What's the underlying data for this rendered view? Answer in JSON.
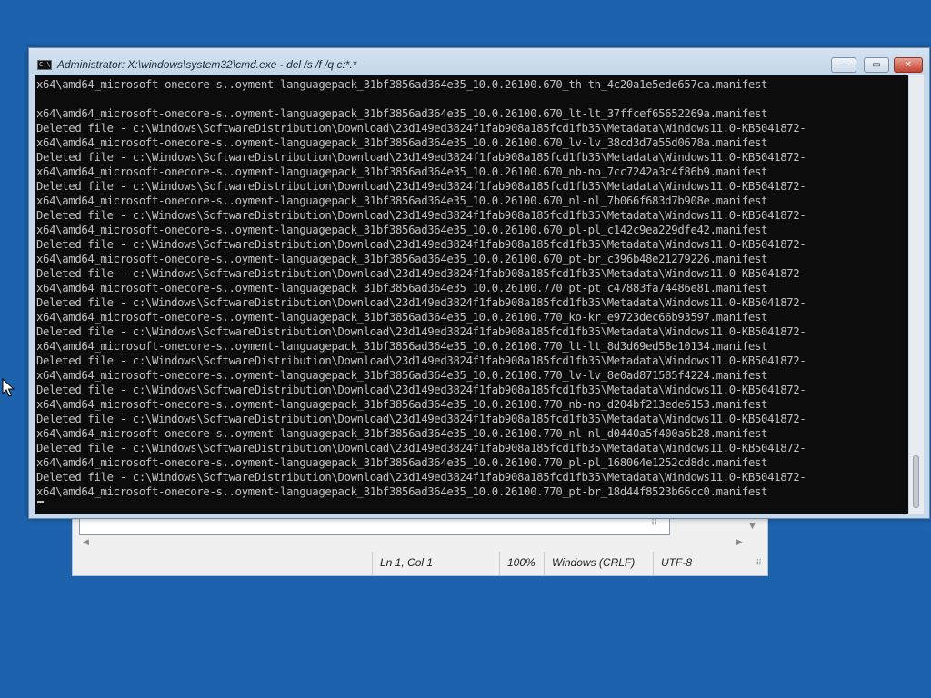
{
  "cmd_window": {
    "title": "Administrator: X:\\windows\\system32\\cmd.exe - del  /s /f /q c:*.*",
    "icon_text": "C:\\",
    "controls": {
      "minimize": "—",
      "maximize": "▭",
      "close": "✕"
    },
    "lines": [
      "x64\\amd64_microsoft-onecore-s..oyment-languagepack_31bf3856ad364e35_10.0.26100.670_th-th_4c20a1e5ede657ca.manifest",
      "",
      "x64\\amd64_microsoft-onecore-s..oyment-languagepack_31bf3856ad364e35_10.0.26100.670_lt-lt_37ffcef65652269a.manifest",
      "Deleted file - c:\\Windows\\SoftwareDistribution\\Download\\23d149ed3824f1fab908a185fcd1fb35\\Metadata\\Windows11.0-KB5041872-",
      "x64\\amd64_microsoft-onecore-s..oyment-languagepack_31bf3856ad364e35_10.0.26100.670_lv-lv_38cd3d7a55d0678a.manifest",
      "Deleted file - c:\\Windows\\SoftwareDistribution\\Download\\23d149ed3824f1fab908a185fcd1fb35\\Metadata\\Windows11.0-KB5041872-",
      "x64\\amd64_microsoft-onecore-s..oyment-languagepack_31bf3856ad364e35_10.0.26100.670_nb-no_7cc7242a3c4f86b9.manifest",
      "Deleted file - c:\\Windows\\SoftwareDistribution\\Download\\23d149ed3824f1fab908a185fcd1fb35\\Metadata\\Windows11.0-KB5041872-",
      "x64\\amd64_microsoft-onecore-s..oyment-languagepack_31bf3856ad364e35_10.0.26100.670_nl-nl_7b066f683d7b908e.manifest",
      "Deleted file - c:\\Windows\\SoftwareDistribution\\Download\\23d149ed3824f1fab908a185fcd1fb35\\Metadata\\Windows11.0-KB5041872-",
      "x64\\amd64_microsoft-onecore-s..oyment-languagepack_31bf3856ad364e35_10.0.26100.670_pl-pl_c142c9ea229dfe42.manifest",
      "Deleted file - c:\\Windows\\SoftwareDistribution\\Download\\23d149ed3824f1fab908a185fcd1fb35\\Metadata\\Windows11.0-KB5041872-",
      "x64\\amd64_microsoft-onecore-s..oyment-languagepack_31bf3856ad364e35_10.0.26100.670_pt-br_c396b48e21279226.manifest",
      "Deleted file - c:\\Windows\\SoftwareDistribution\\Download\\23d149ed3824f1fab908a185fcd1fb35\\Metadata\\Windows11.0-KB5041872-",
      "x64\\amd64_microsoft-onecore-s..oyment-languagepack_31bf3856ad364e35_10.0.26100.770_pt-pt_c47883fa74486e81.manifest",
      "Deleted file - c:\\Windows\\SoftwareDistribution\\Download\\23d149ed3824f1fab908a185fcd1fb35\\Metadata\\Windows11.0-KB5041872-",
      "x64\\amd64_microsoft-onecore-s..oyment-languagepack_31bf3856ad364e35_10.0.26100.770_ko-kr_e9723dec66b93597.manifest",
      "Deleted file - c:\\Windows\\SoftwareDistribution\\Download\\23d149ed3824f1fab908a185fcd1fb35\\Metadata\\Windows11.0-KB5041872-",
      "x64\\amd64_microsoft-onecore-s..oyment-languagepack_31bf3856ad364e35_10.0.26100.770_lt-lt_8d3d69ed58e10134.manifest",
      "Deleted file - c:\\Windows\\SoftwareDistribution\\Download\\23d149ed3824f1fab908a185fcd1fb35\\Metadata\\Windows11.0-KB5041872-",
      "x64\\amd64_microsoft-onecore-s..oyment-languagepack_31bf3856ad364e35_10.0.26100.770_lv-lv_8e0ad871585f4224.manifest",
      "Deleted file - c:\\Windows\\SoftwareDistribution\\Download\\23d149ed3824f1fab908a185fcd1fb35\\Metadata\\Windows11.0-KB5041872-",
      "x64\\amd64_microsoft-onecore-s..oyment-languagepack_31bf3856ad364e35_10.0.26100.770_nb-no_d204bf213ede6153.manifest",
      "Deleted file - c:\\Windows\\SoftwareDistribution\\Download\\23d149ed3824f1fab908a185fcd1fb35\\Metadata\\Windows11.0-KB5041872-",
      "x64\\amd64_microsoft-onecore-s..oyment-languagepack_31bf3856ad364e35_10.0.26100.770_nl-nl_d0440a5f400a6b28.manifest",
      "Deleted file - c:\\Windows\\SoftwareDistribution\\Download\\23d149ed3824f1fab908a185fcd1fb35\\Metadata\\Windows11.0-KB5041872-",
      "x64\\amd64_microsoft-onecore-s..oyment-languagepack_31bf3856ad364e35_10.0.26100.770_pl-pl_168064e1252cd8dc.manifest",
      "Deleted file - c:\\Windows\\SoftwareDistribution\\Download\\23d149ed3824f1fab908a185fcd1fb35\\Metadata\\Windows11.0-KB5041872-",
      "x64\\amd64_microsoft-onecore-s..oyment-languagepack_31bf3856ad364e35_10.0.26100.770_pt-br_18d44f8523b66cc0.manifest"
    ]
  },
  "notepad": {
    "status": {
      "position": "Ln 1, Col 1",
      "zoom": "100%",
      "line_ending": "Windows (CRLF)",
      "encoding": "UTF-8"
    }
  },
  "icons": {
    "cmd": "command-prompt-icon",
    "pointer": "mouse-pointer-icon"
  },
  "colors": {
    "desktop": "#1c62ad",
    "console_bg": "#0c0c0c",
    "console_text": "#c0c0c0"
  }
}
